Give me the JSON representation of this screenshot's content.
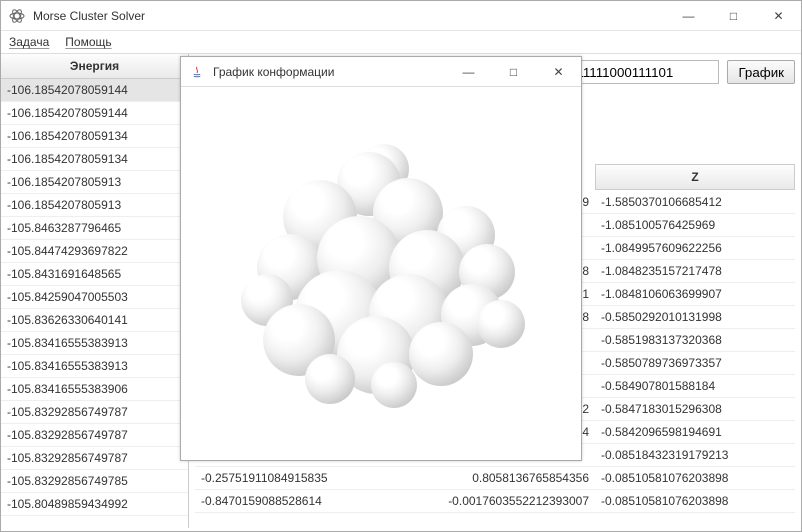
{
  "main_window": {
    "title": "Morse Cluster Solver",
    "winbtns": {
      "min": "—",
      "max": "□",
      "close": "✕"
    }
  },
  "menu": {
    "task": "Задача",
    "help": "Помощь"
  },
  "energy": {
    "header": "Энергия",
    "rows": [
      "-106.18542078059144",
      "-106.18542078059144",
      "-106.18542078059134",
      "-106.18542078059134",
      "-106.1854207805913",
      "-106.1854207805913",
      "-105.8463287796465",
      "-105.84474293697822",
      "-105.8431691648565",
      "-105.84259047005503",
      "-105.83626330640141",
      "-105.83416555383913",
      "-105.83416555383913",
      "-105.83416555383906",
      "-105.83292856749787",
      "-105.83292856749787",
      "-105.83292856749787",
      "-105.83292856749785",
      "-105.80489859434992"
    ]
  },
  "top_strip": {
    "conf_value": "11111000111101",
    "graph_btn": "График"
  },
  "filter_input": "",
  "coord": {
    "z_header": "Z",
    "rows": [
      {
        "x": "",
        "y": "489",
        "z": "-1.5850370106685412"
      },
      {
        "x": "",
        "y": "",
        "z": "-1.085100576425969"
      },
      {
        "x": "",
        "y": "",
        "z": "-1.0849957609622256"
      },
      {
        "x": "",
        "y": "798",
        "z": "-1.0848235157217478"
      },
      {
        "x": "",
        "y": "1",
        "z": "-1.0848106063699907"
      },
      {
        "x": "",
        "y": "988",
        "z": "-0.5850292010131998"
      },
      {
        "x": "",
        "y": "",
        "z": "-0.5851983137320368"
      },
      {
        "x": "",
        "y": "",
        "z": "-0.5850789736973357"
      },
      {
        "x": "",
        "y": "",
        "z": "-0.584907801588184"
      },
      {
        "x": "",
        "y": "2",
        "z": "-0.5847183015296308"
      },
      {
        "x": "",
        "y": "4",
        "z": "-0.5842096598194691"
      },
      {
        "x": "",
        "y": "",
        "z": "-0.08518432319179213"
      },
      {
        "x": "-0.25751911084915835",
        "y": "0.8058136765854356",
        "z": "-0.08510581076203898"
      },
      {
        "x": "-0.8470159088528614",
        "y": "-0.0017603552212393007",
        "z": "-0.08510581076203898"
      }
    ]
  },
  "child_window": {
    "title": "График конформации",
    "winbtns": {
      "min": "—",
      "max": "□",
      "close": "✕"
    }
  }
}
